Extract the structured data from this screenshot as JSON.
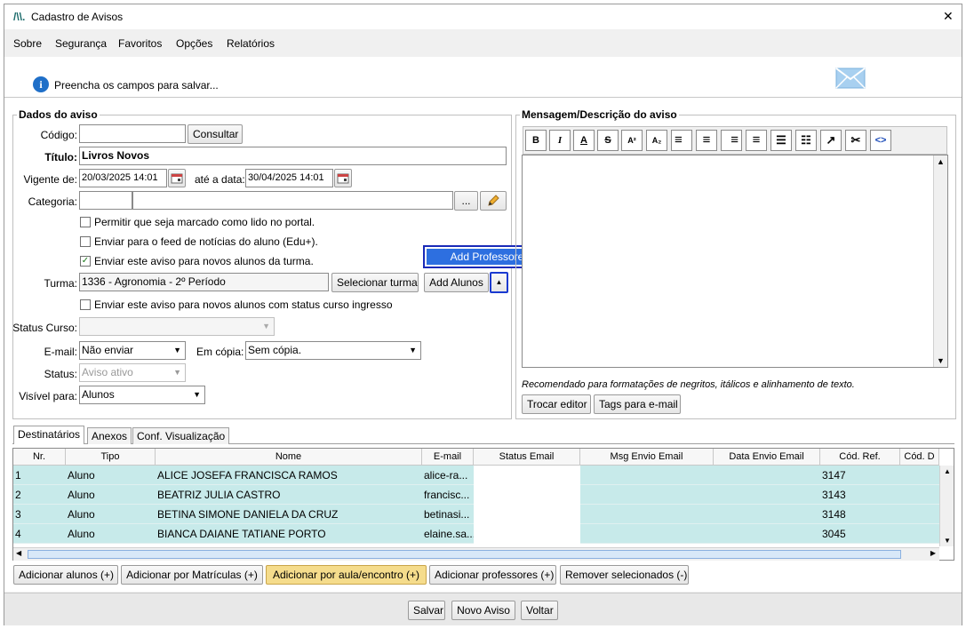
{
  "window": {
    "title": "Cadastro de Avisos",
    "close": "✕"
  },
  "menu": [
    "Sobre",
    "Segurança",
    "Favoritos",
    "Opções",
    "Relatórios"
  ],
  "info": {
    "text": "Preencha os campos para salvar..."
  },
  "aviso": {
    "legend": "Dados do aviso",
    "codigo_label": "Código:",
    "codigo_value": "",
    "consultar": "Consultar",
    "titulo_label": "Título:",
    "titulo_value": "Livros Novos",
    "vigente_label": "Vigente de:",
    "vigente_value": "20/03/2025 14:01",
    "ate_label": "até a data:",
    "ate_value": "30/04/2025 14:01",
    "categoria_label": "Categoria:",
    "categoria_btn": "...",
    "chk1": "Permitir que seja marcado como lido no portal.",
    "chk2": "Enviar para o feed de notícias do aluno (Edu+).",
    "chk3": "Enviar este aviso para novos alunos da turma.",
    "turma_label": "Turma:",
    "turma_value": "1336 - Agronomia - 2º Período",
    "selecionar_turma": "Selecionar turma",
    "add_alunos": "Add Alunos",
    "dropdown_item": "Add Professores",
    "chk4": "Enviar este aviso para novos alunos com status curso ingresso",
    "status_curso_label": "Status Curso:",
    "email_label": "E-mail:",
    "email_value": "Não enviar",
    "copia_label": "Em cópia:",
    "copia_value": "Sem cópia.",
    "status_label": "Status:",
    "status_value": "Aviso ativo",
    "visivel_label": "Visível para:",
    "visivel_value": "Alunos"
  },
  "mensagem": {
    "legend": "Mensagem/Descrição do aviso",
    "hint": "Recomendado para formatações de negritos, itálicos e alinhamento de texto.",
    "trocar_editor": "Trocar editor",
    "tags": "Tags para e-mail",
    "toolbar": [
      "B",
      "I",
      "A",
      "S",
      "A²",
      "A₂",
      "≡",
      "≡",
      "≡",
      "≡",
      "☰",
      "☷",
      "↗",
      "✂",
      "<>"
    ]
  },
  "tabs": [
    "Destinatários",
    "Anexos",
    "Conf. Visualização"
  ],
  "grid": {
    "columns": [
      "Nr.",
      "Tipo",
      "Nome",
      "E-mail",
      "Status Email",
      "Msg Envio Email",
      "Data Envio Email",
      "Cód. Ref.",
      "Cód. D"
    ],
    "rows": [
      {
        "nr": "1",
        "tipo": "Aluno",
        "nome": "ALICE JOSEFA FRANCISCA RAMOS",
        "email": "alice-ra...",
        "ref": "3147"
      },
      {
        "nr": "2",
        "tipo": "Aluno",
        "nome": "BEATRIZ JULIA CASTRO",
        "email": "francisc...",
        "ref": "3143"
      },
      {
        "nr": "3",
        "tipo": "Aluno",
        "nome": "BETINA SIMONE DANIELA DA CRUZ",
        "email": "betinasi...",
        "ref": "3148"
      },
      {
        "nr": "4",
        "tipo": "Aluno",
        "nome": "BIANCA DAIANE TATIANE PORTO",
        "email": "elaine.sa...",
        "ref": "3045"
      }
    ]
  },
  "bottom_buttons": [
    "Adicionar alunos (+)",
    "Adicionar por Matrículas (+)",
    "Adicionar por aula/encontro (+)",
    "Adicionar professores (+)",
    "Remover selecionados (-)"
  ],
  "footer": {
    "salvar": "Salvar",
    "novo": "Novo Aviso",
    "voltar": "Voltar"
  },
  "colors": {
    "row_bg": "#c7eaea",
    "highlight_btn": "#f5dc8c",
    "dropdown_bg": "#2d6fe0"
  }
}
